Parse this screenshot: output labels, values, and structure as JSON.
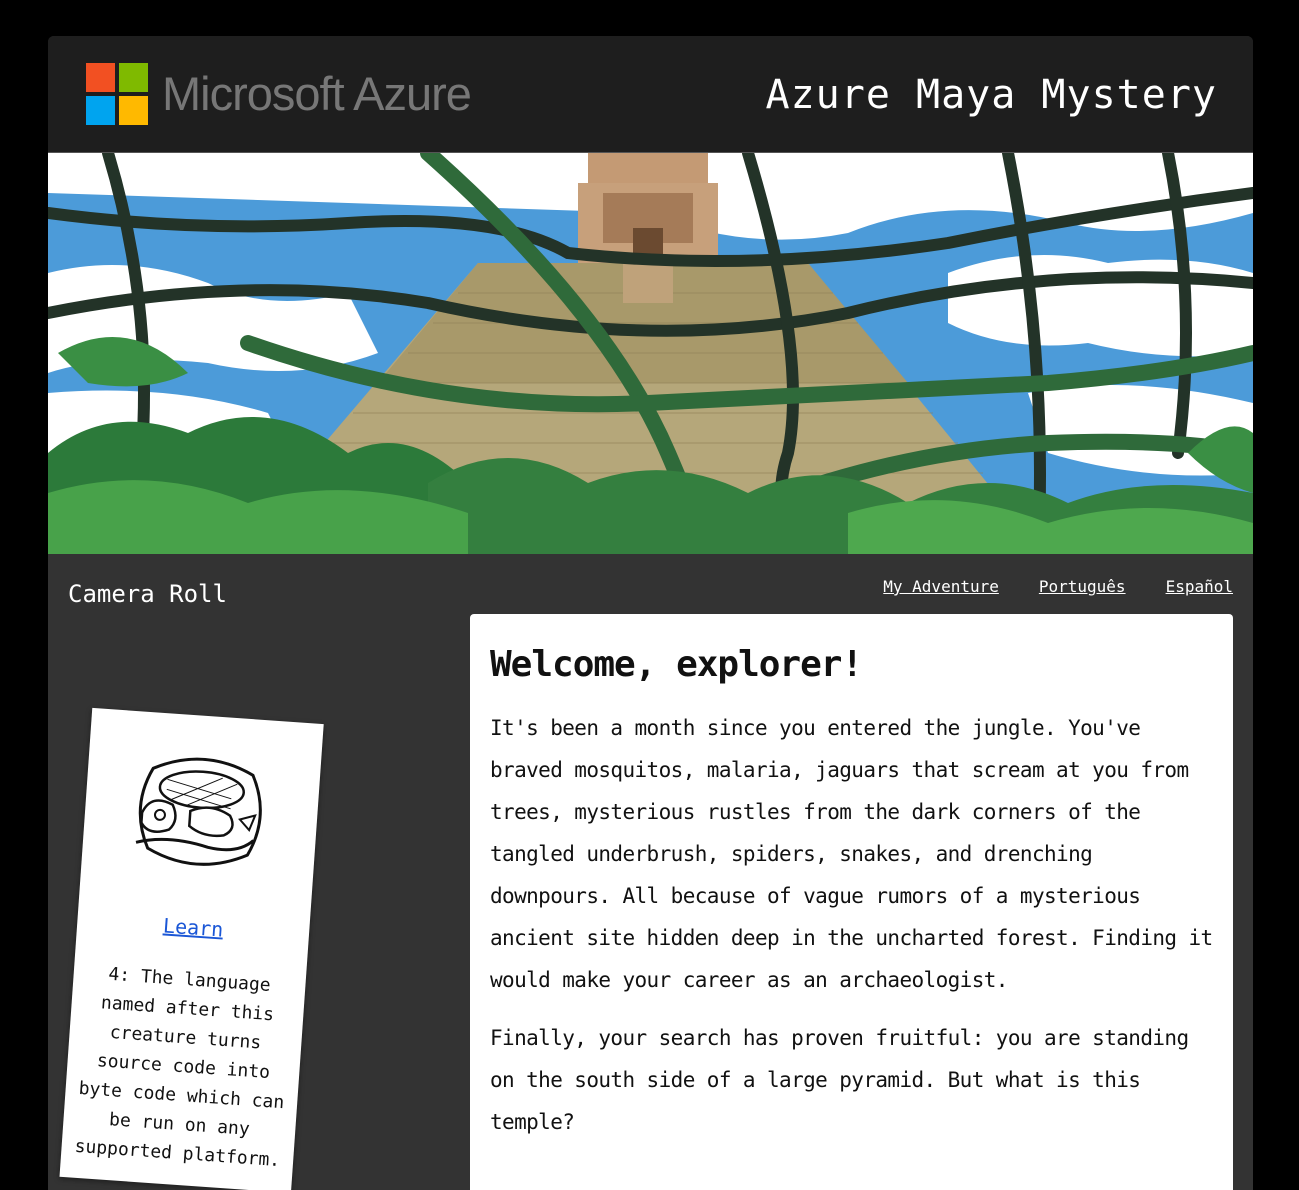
{
  "header": {
    "brand_text": "Microsoft Azure",
    "game_title": "Azure Maya Mystery",
    "logo_colors": [
      "#f25022",
      "#7fba00",
      "#00a4ef",
      "#ffb900"
    ]
  },
  "banner": {
    "image_alt": "jungle-pyramid-illustration"
  },
  "sidebar": {
    "title": "Camera Roll",
    "card": {
      "glyph_icon": "maya-glyph-serpent-icon",
      "link_label": "Learn",
      "clue_text": "4: The language named after this creature turns source code into byte code which can be run on any supported platform."
    }
  },
  "nav": {
    "links": [
      {
        "label": "My Adventure"
      },
      {
        "label": "Português"
      },
      {
        "label": "Español"
      }
    ]
  },
  "main": {
    "heading": "Welcome, explorer!",
    "paragraphs": [
      "It's been a month since you entered the jungle. You've braved mosquitos, malaria, jaguars that scream at you from trees, mysterious rustles from the dark corners of the tangled underbrush, spiders, snakes, and drenching downpours. All because of vague rumors of a mysterious ancient site hidden deep in the uncharted forest. Finding it would make your career as an archaeologist.",
      "Finally, your search has proven fruitful: you are standing on the south side of a large pyramid. But what is this temple?"
    ]
  },
  "colors": {
    "page_bg": "#000000",
    "header_bg": "#1e1e1e",
    "panel_bg": "#333333",
    "sky": "#4c9bd9",
    "link_blue": "#1a56d6"
  }
}
